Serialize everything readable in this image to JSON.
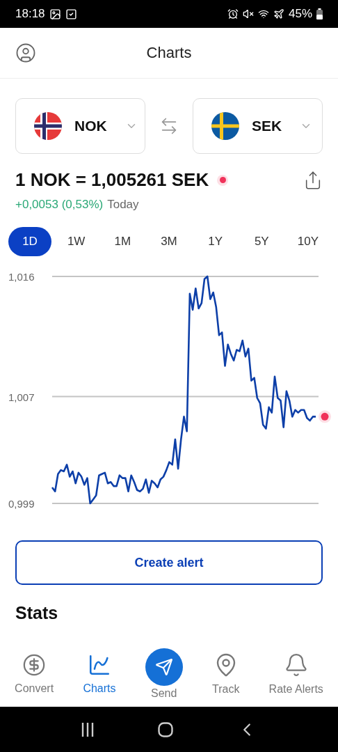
{
  "status_bar": {
    "time": "18:18",
    "battery": "45%"
  },
  "header": {
    "title": "Charts"
  },
  "pair": {
    "from": {
      "code": "NOK"
    },
    "to": {
      "code": "SEK"
    }
  },
  "rate": {
    "text": "1 NOK = 1,005261 SEK",
    "change": "+0,0053 (0,53%)",
    "period": "Today",
    "live": true
  },
  "ranges": [
    {
      "label": "1D",
      "selected": true
    },
    {
      "label": "1W",
      "selected": false
    },
    {
      "label": "1M",
      "selected": false
    },
    {
      "label": "3M",
      "selected": false
    },
    {
      "label": "1Y",
      "selected": false
    },
    {
      "label": "5Y",
      "selected": false
    },
    {
      "label": "10Y",
      "selected": false
    }
  ],
  "chart": {
    "chart_data": {
      "type": "line",
      "ylim": [
        0.999,
        1.016
      ],
      "yticks": [
        {
          "value": 1.016,
          "label": "1,016"
        },
        {
          "value": 1.007,
          "label": "1,007"
        },
        {
          "value": 0.999,
          "label": "0,999"
        }
      ],
      "series": [
        {
          "color": "#0d3fa8",
          "values": [
            1.0002,
            0.9999,
            1.0012,
            1.0015,
            1.0014,
            1.0019,
            1.001,
            1.0014,
            1.0005,
            1.0013,
            1.001,
            1.0004,
            1.0009,
            0.999,
            0.9993,
            0.9996,
            1.0011,
            1.0012,
            1.0013,
            1.0005,
            1.0006,
            1.0003,
            1.0003,
            1.0011,
            1.0009,
            1.0009,
            0.9999,
            1.0011,
            1.0006,
            1.0,
            0.9999,
            1.0001,
            1.0008,
            0.9998,
            1.0007,
            1.0005,
            1.0002,
            1.0008,
            1.001,
            1.0015,
            1.0021,
            1.0019,
            1.0038,
            1.0016,
            1.0038,
            1.0055,
            1.0044,
            1.0147,
            1.0135,
            1.0151,
            1.0136,
            1.014,
            1.0158,
            1.016,
            1.0143,
            1.0148,
            1.0137,
            1.0116,
            1.0118,
            1.0093,
            1.0109,
            1.0102,
            1.0097,
            1.0105,
            1.0104,
            1.0112,
            1.01,
            1.0106,
            1.0082,
            1.0084,
            1.0069,
            1.0065,
            1.0049,
            1.0046,
            1.0062,
            1.0058,
            1.0085,
            1.0069,
            1.0067,
            1.0047,
            1.0074,
            1.0067,
            1.0055,
            1.006,
            1.0058,
            1.006,
            1.006,
            1.0054,
            1.0052,
            1.0055,
            1.0055
          ]
        }
      ]
    }
  },
  "alert_button": "Create alert",
  "stats": {
    "title": "Stats"
  },
  "nav": [
    {
      "label": "Convert",
      "selected": false
    },
    {
      "label": "Charts",
      "selected": true
    },
    {
      "label": "Send",
      "selected": false
    },
    {
      "label": "Track",
      "selected": false
    },
    {
      "label": "Rate Alerts",
      "selected": false
    }
  ]
}
